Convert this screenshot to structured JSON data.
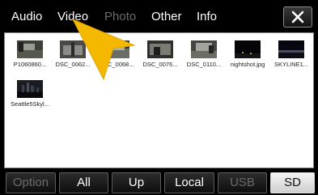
{
  "tabs": [
    {
      "label": "Audio",
      "enabled": true
    },
    {
      "label": "Video",
      "enabled": true
    },
    {
      "label": "Photo",
      "enabled": false
    },
    {
      "label": "Other",
      "enabled": true
    },
    {
      "label": "Info",
      "enabled": true
    }
  ],
  "close_icon": "close-x-icon",
  "files": [
    {
      "name": "P1060860...",
      "thumb": "landscape-dark"
    },
    {
      "name": "DSC_0062...",
      "thumb": "landscape-dark"
    },
    {
      "name": "DSC_0068...",
      "thumb": "landscape-dark"
    },
    {
      "name": "DSC_0076...",
      "thumb": "landscape-dark"
    },
    {
      "name": "DSC_0110...",
      "thumb": "landscape-dark"
    },
    {
      "name": "nightshot.jpg",
      "thumb": "night"
    },
    {
      "name": "SKYLINE1...",
      "thumb": "night"
    },
    {
      "name": "Seattle5Skyl...",
      "thumb": "skyline"
    }
  ],
  "toolbar": {
    "option": "Option",
    "all": "All",
    "up": "Up",
    "local": "Local",
    "usb": "USB",
    "sd": "SD"
  },
  "colors": {
    "panel_bg": "#ffffff",
    "selected_button": "#e8e8e8",
    "pointer": "#f5b800"
  }
}
